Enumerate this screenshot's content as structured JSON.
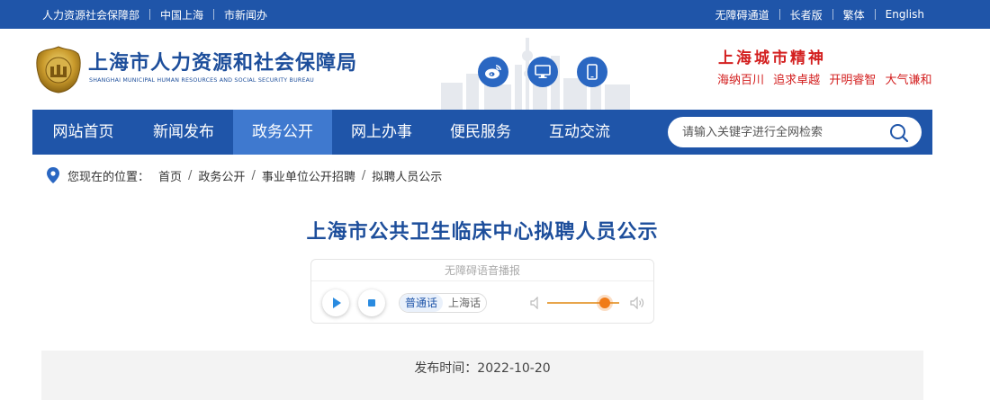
{
  "topbar": {
    "left_links": [
      "人力资源社会保障部",
      "中国上海",
      "市新闻办"
    ],
    "right_links": [
      "无障碍通道",
      "长者版",
      "繁体",
      "English"
    ]
  },
  "header": {
    "logo_title": "上海市人力资源和社会保障局",
    "logo_subtitle": "SHANGHAI MUNICIPAL HUMAN RESOURCES AND SOCIAL SECURITY BUREAU",
    "spirit_title": "上海城市精神",
    "spirit_phrases": [
      "海纳百川",
      "追求卓越",
      "开明睿智",
      "大气谦和"
    ]
  },
  "nav": {
    "items": [
      "网站首页",
      "新闻发布",
      "政务公开",
      "网上办事",
      "便民服务",
      "互动交流"
    ],
    "active_index": 2,
    "search_placeholder": "请输入关键字进行全网检索"
  },
  "breadcrumb": {
    "label": "您现在的位置：",
    "items": [
      "首页",
      "政务公开",
      "事业单位公开招聘",
      "拟聘人员公示"
    ]
  },
  "article": {
    "title": "上海市公共卫生临床中心拟聘人员公示",
    "publish_text": "发布时间：2022-10-20"
  },
  "player": {
    "title": "无障碍语音播报",
    "languages": [
      "普通话",
      "上海话"
    ],
    "active_language": 0,
    "volume": 0.8
  },
  "colors": {
    "primary": "#1f55a9",
    "nav_active": "#3f79cf",
    "title": "#1d4e9b",
    "spirit": "#d31f1f",
    "volume": "#f07b18"
  }
}
